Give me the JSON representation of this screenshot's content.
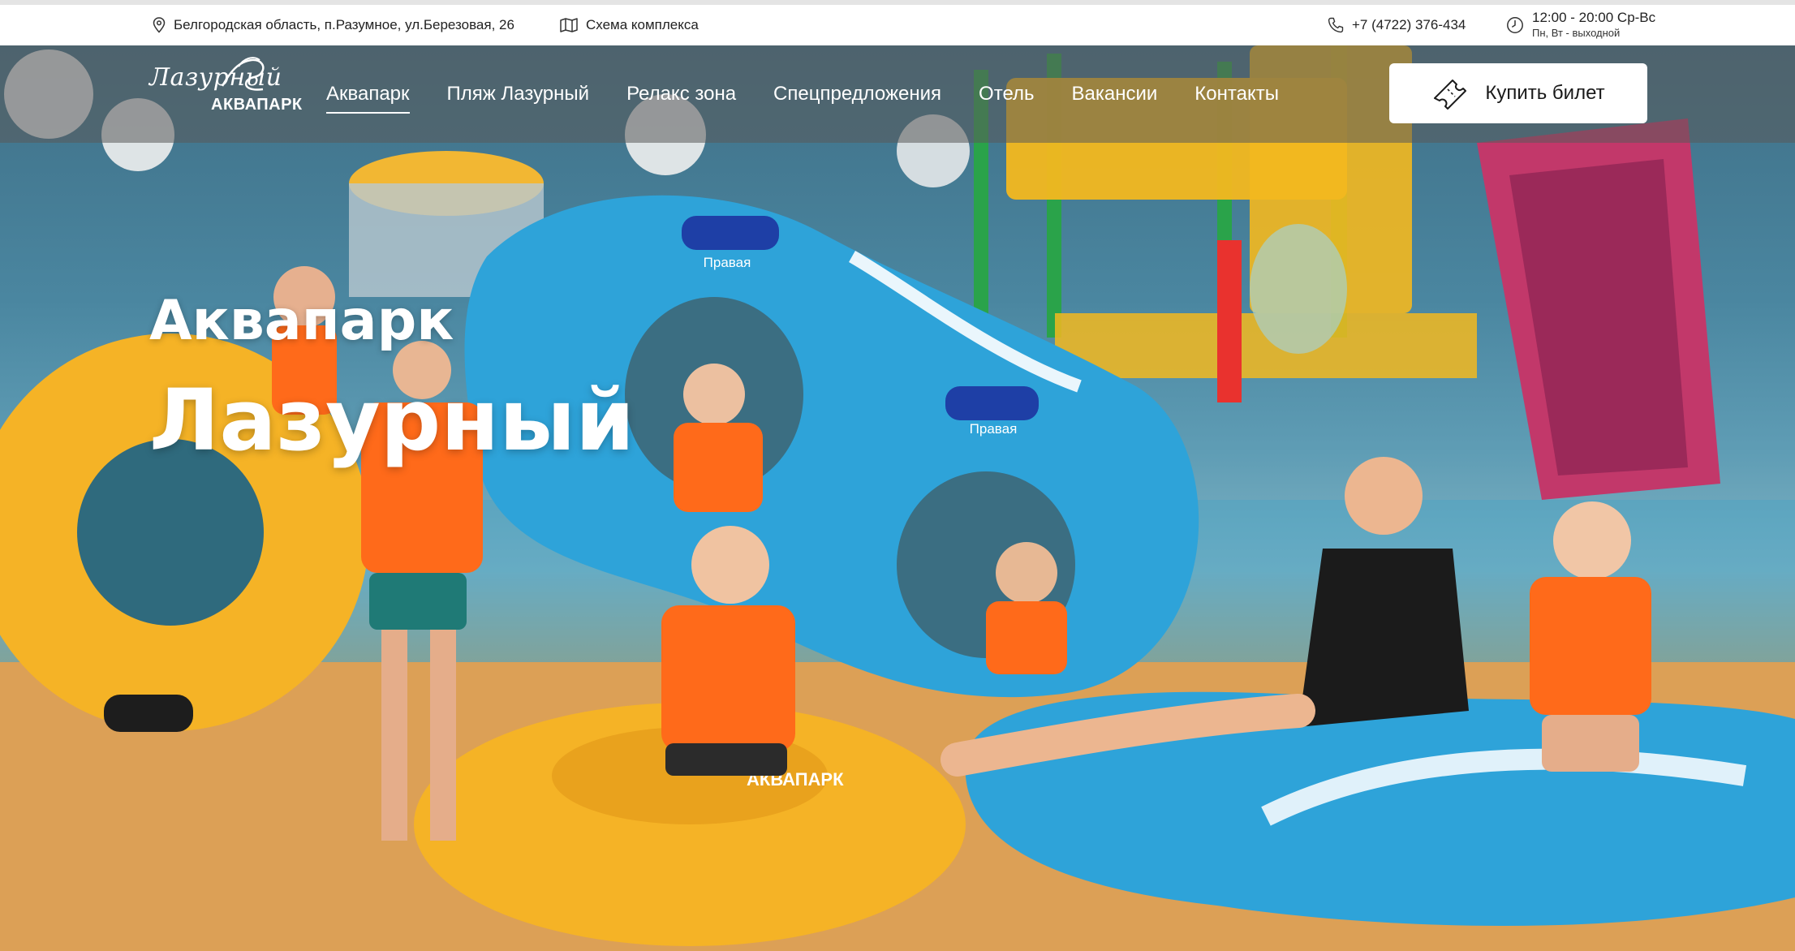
{
  "topbar": {
    "address": "Белгородская область, п.Разумное, ул.Березовая, 26",
    "scheme_link": "Схема комплекса",
    "phone": "+7 (4722) 376-434",
    "hours_main": "12:00 - 20:00 Ср-Вс",
    "hours_sub": "Пн, Вт - выходной"
  },
  "logo": {
    "script_text": "Лазурный",
    "caps_text": "АКВАПАРК"
  },
  "nav": {
    "items": [
      {
        "label": "Аквапарк",
        "active": true
      },
      {
        "label": "Пляж Лазурный"
      },
      {
        "label": "Релакс зона"
      },
      {
        "label": "Спецпредложения"
      },
      {
        "label": "Отель"
      },
      {
        "label": "Вакансии"
      },
      {
        "label": "Контакты"
      }
    ],
    "buy_label": "Купить билет"
  },
  "hero": {
    "title_line1": "Аквапарк",
    "title_line2": "Лазурный",
    "tube_label_1": "Правая",
    "tube_label_2": "Правая",
    "tube_brand_caps": "АКВАПАРК"
  },
  "colors": {
    "tube_orange": "#f5b326",
    "tube_blue": "#2ea3d9",
    "vest_orange": "#ff6a1a",
    "slide_pink": "#c2386a",
    "frame_yellow": "#f3b81f"
  }
}
